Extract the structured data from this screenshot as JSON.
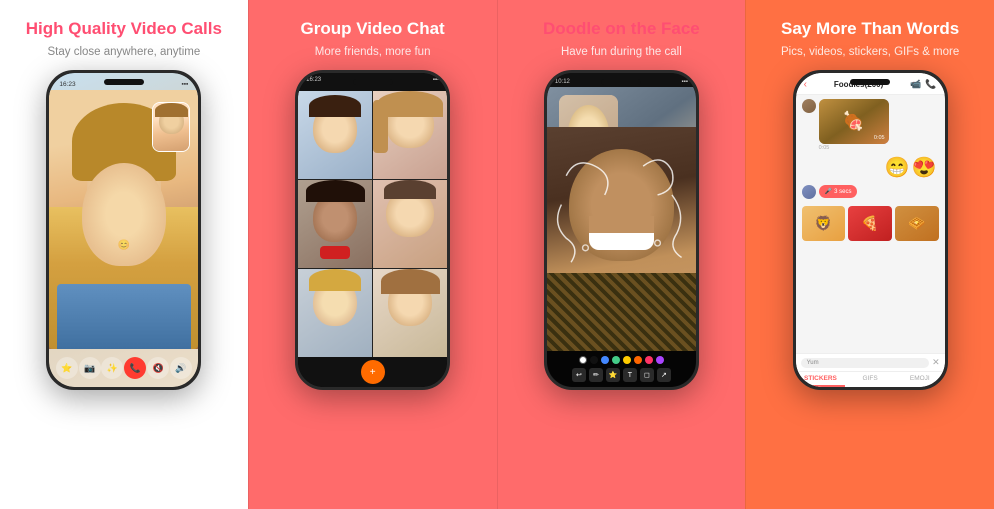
{
  "panels": [
    {
      "id": "panel-1",
      "title": "High Quality Video Calls",
      "subtitle": "Stay close anywhere, anytime",
      "bg": "white",
      "titleColor": "#ff4e72"
    },
    {
      "id": "panel-2",
      "title": "Group Video Chat",
      "subtitle": "More friends, more fun",
      "bg": "coral",
      "titleColor": "#ffffff"
    },
    {
      "id": "panel-3",
      "title": "Doodle on the Face",
      "subtitle": "Have fun during the call",
      "bg": "coral",
      "titleColor": "#ff4e72"
    },
    {
      "id": "panel-4",
      "title": "Say More Than Words",
      "subtitle": "Pics, videos, stickers, GIFs & more",
      "bg": "orange-red",
      "titleColor": "#ffffff"
    }
  ],
  "panel4": {
    "chatTitle": "Foodies(200)",
    "inputPlaceholder": "Yum",
    "tabs": [
      "STICKERS",
      "GIFS",
      "EMOJI"
    ],
    "activeTab": "STICKERS",
    "voiceMsg": "3 secs"
  },
  "colors": {
    "coral": "#ff6b6b",
    "pink": "#ff4e72",
    "white": "#ffffff"
  }
}
